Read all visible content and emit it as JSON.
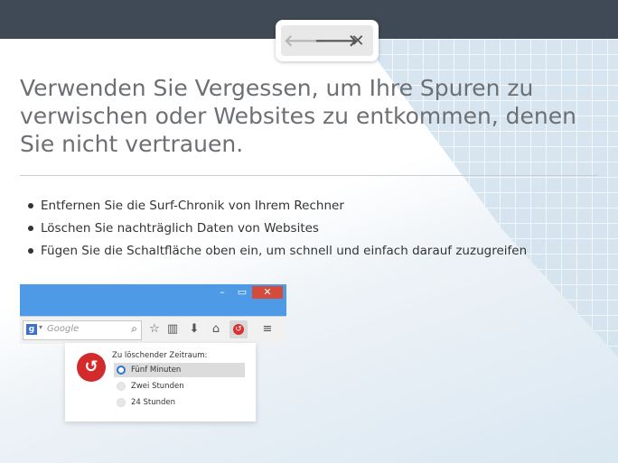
{
  "nav": {
    "back_icon": "arrow-left",
    "forward_icon": "arrow-right",
    "close_icon": "x",
    "back_glyph": "🡐",
    "forward_glyph": "🡒",
    "close_glyph": "✕"
  },
  "heading": "Verwenden Sie Vergessen, um Ihre Spuren zu verwischen oder Websites zu entkommen, denen Sie nicht vertrauen.",
  "bullets": [
    "Entfernen Sie die Surf-Chronik von Ihrem Rechner",
    "Löschen Sie nachträglich Daten von Websites",
    "Fügen Sie die Schaltfläche oben ein, um schnell und einfach darauf zuzugreifen"
  ],
  "browser": {
    "search_placeholder": "Google",
    "search_engine_glyph": "g",
    "window_controls": {
      "minimize": "–",
      "maximize": "▭",
      "close": "✕"
    },
    "toolbar_glyphs": {
      "bookmark": "☆",
      "library": "▥",
      "download": "⬇",
      "home": "⌂",
      "forget": "↺",
      "menu": "≡",
      "search": "⌕"
    }
  },
  "forget_panel": {
    "title": "Zu löschender Zeitraum:",
    "options": [
      {
        "label": "Fünf Minuten",
        "selected": true
      },
      {
        "label": "Zwei Stunden",
        "selected": false
      },
      {
        "label": "24 Stunden",
        "selected": false
      }
    ],
    "logo_glyph": "↺"
  },
  "colors": {
    "topbar": "#3f4a56",
    "browser_titlebar": "#4e9ae6",
    "forget_red": "#d32b2b",
    "radio_selected": "#2b73d6"
  }
}
